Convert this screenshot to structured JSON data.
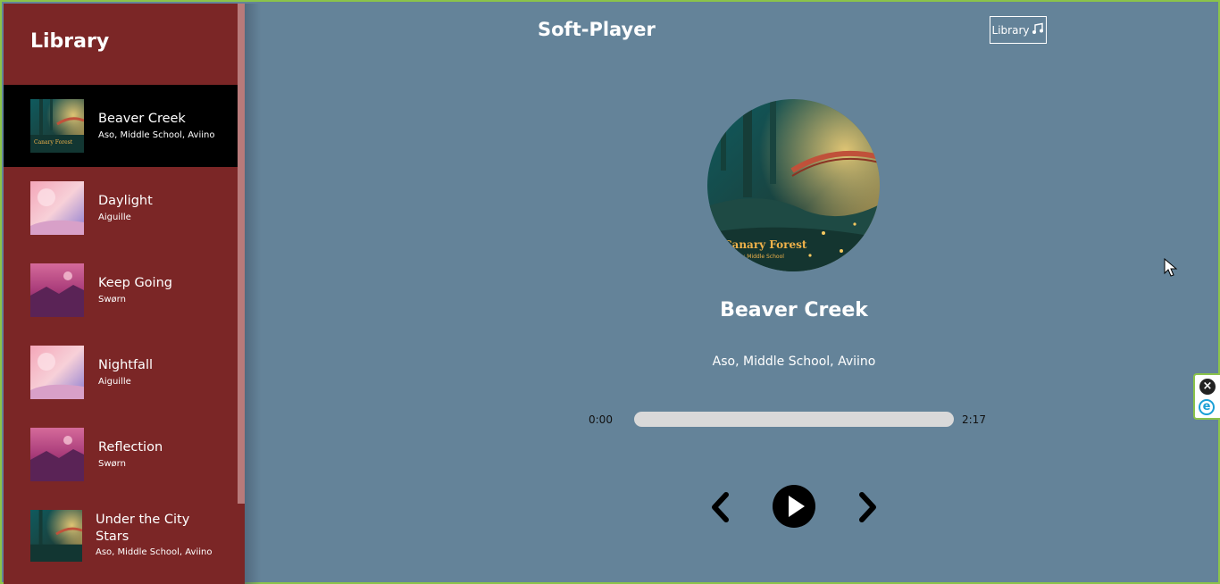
{
  "sidebar": {
    "title": "Library",
    "songs": [
      {
        "name": "Beaver Creek",
        "artist": "Aso, Middle School, Aviino",
        "active": true,
        "art": "forest"
      },
      {
        "name": "Daylight",
        "artist": "Aiguille",
        "active": false,
        "art": "pink"
      },
      {
        "name": "Keep Going",
        "artist": "Swørn",
        "active": false,
        "art": "magenta"
      },
      {
        "name": "Nightfall",
        "artist": "Aiguille",
        "active": false,
        "art": "pink"
      },
      {
        "name": "Reflection",
        "artist": "Swørn",
        "active": false,
        "art": "magenta"
      },
      {
        "name": "Under the City Stars",
        "artist": "Aso, Middle School, Aviino",
        "active": false,
        "art": "forest"
      }
    ]
  },
  "header": {
    "app_title": "Soft-Player",
    "library_button": "Library",
    "library_icon": "music-note-icon"
  },
  "player": {
    "title": "Beaver Creek",
    "artist": "Aso, Middle School, Aviino",
    "cover_text": "Canary Forest",
    "cover_subtext": "Aso x Middle School",
    "time_current": "0:00",
    "time_total": "2:17",
    "progress": 0,
    "controls": {
      "prev": "chevron-left-icon",
      "play": "play-icon",
      "next": "chevron-right-icon"
    }
  },
  "colors": {
    "sidebar_bg": "#7b2626",
    "main_bg": "#648399",
    "active_item_bg": "#000000",
    "progress_track": "#d9d9d9"
  },
  "extension": {
    "close_icon": "close-icon",
    "logo_icon": "e-logo-icon",
    "logo_letter": "e"
  }
}
